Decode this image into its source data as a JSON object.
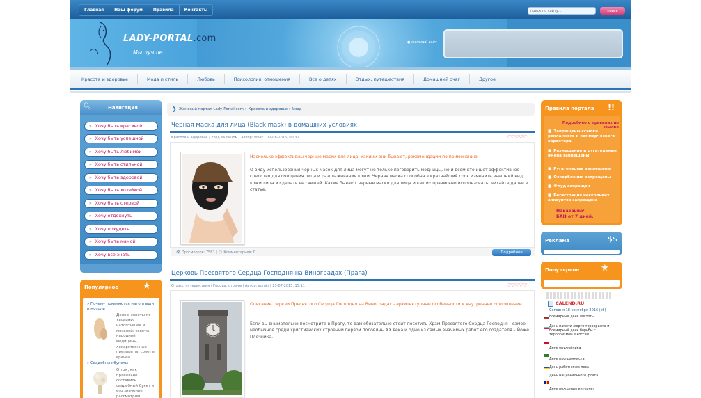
{
  "topnav": {
    "items": [
      "Главная",
      "Наш форум",
      "Правила",
      "Контакты"
    ]
  },
  "search": {
    "placeholder": "поиск по сайту...",
    "button_label": "поиск"
  },
  "header": {
    "logo_main": "LADY-PORTAL",
    "logo_domain": ".com",
    "slogan": "Мы лучше",
    "banner_caption": "женский сайт"
  },
  "category_nav": {
    "items": [
      "Красота и здоровье",
      "Мода и стиль",
      "Любовь",
      "Психология, отношения",
      "Все о детях",
      "Отдых, путешествия",
      "Домашний очаг",
      "Другое"
    ]
  },
  "navigation": {
    "title": "Навигация",
    "items": [
      "Хочу быть красивой",
      "Хочу быть успешной",
      "Хочу быть любимой",
      "Хочу быть стильной",
      "Хочу быть здоровой",
      "Хочу быть хозяйкой",
      "Хочу быть стервой",
      "Хочу отдохнуть",
      "Хочу похудеть",
      "Хочу быть мамой",
      "Хочу все знать"
    ]
  },
  "popular_left": {
    "title": "Популярное",
    "items": [
      {
        "link": "» Почему появляются натоптыши и мозоли",
        "text": "Дело в советы по лечению натоптышей и мозолей: советы народной медицины, лекарственные препараты, советы врачей.",
        "more": "Читать далее »"
      },
      {
        "link": "» Свадебные букеты",
        "text": "О том, как правильно составить свадебный букет и его значение, рассмотрим основные тренды и советы по выбору цветов."
      }
    ]
  },
  "breadcrumb": "Женский портал Lady-Portal.com » Красота и здоровье » Уход",
  "articles": [
    {
      "title": "Черная маска для лица (Black mask) в домашних условиях",
      "meta": "Красота и здоровье / Уход за лицом | Автор: vivak | 07-08-2015, 00:32",
      "lead": "Насколько эффективны черные маски для лица, какими они бывают, рекомендации по применению",
      "text": "О виду использования черных масок для лица могут не только поговорить модницы, но и всем кто ищет эффективное средство для очищения лица и разглаживания кожи. Черная маска способна в кратчайший срок изменить внешний вид кожи лица и сделать ее свежей. Какие бывают черные маски для лица и как их правильно использовать, читайте далее в статье.",
      "views": "Просмотров: 7587",
      "comments": "Комментариев: 0",
      "more": "Подробнее",
      "image": "black-mask-photo"
    },
    {
      "title": "Церковь Пресвятого Сердца Господня на Виноградах (Прага)",
      "meta": "Отдых, путешествия / Города, страны | Автор: admin | 25-07-2015, 15:11",
      "lead": "Описание Церкви Пресвятого Сердца Господня на Виноградах - архитектурные особенности и внутреннее оформление.",
      "text": "Если вы внимательно посмотрите в Прагу, то вам обязательно стоит посетить Храм Пресвятого Сердца Господня - самое необычное среди христианских строений первой половины XX века и одно из самых значимых работ его создателя – Йоже Плечника.",
      "image": "church-photo"
    }
  ],
  "rules": {
    "title": "Правила портала",
    "subtitle": "Подробнее о правилах по ссылке",
    "items": [
      "Запрещены ссылки рекламного и коммерческого характера",
      "Размещение и ругательные имена запрещены",
      "Ругательства запрещены",
      "Оскорбления запрещены",
      "Флуд запрещен",
      "Регистрация нескольких аккаунтов запрещена"
    ],
    "penalty_line1": "Наказание:",
    "penalty_line2": "БАН от 7 дней."
  },
  "ad_block": {
    "title": "Реклама"
  },
  "popular_right": {
    "title": "Популярное"
  },
  "calendar": {
    "title": "CALEND.RU",
    "date": "Сегодня 18 сентября 2016 (сб)",
    "events": [
      "Всемирный день чистоты",
      "День памяти жертв терроризма и Всемирный день борьбы с терроризмом в России",
      "День оружейника",
      "День программиста",
      "День работников леса",
      "День национального флага",
      "День рождения интернет"
    ]
  },
  "colors": {
    "primary_blue": "#2f73b2",
    "accent_orange": "#f7941d",
    "accent_pink": "#c2185b"
  }
}
